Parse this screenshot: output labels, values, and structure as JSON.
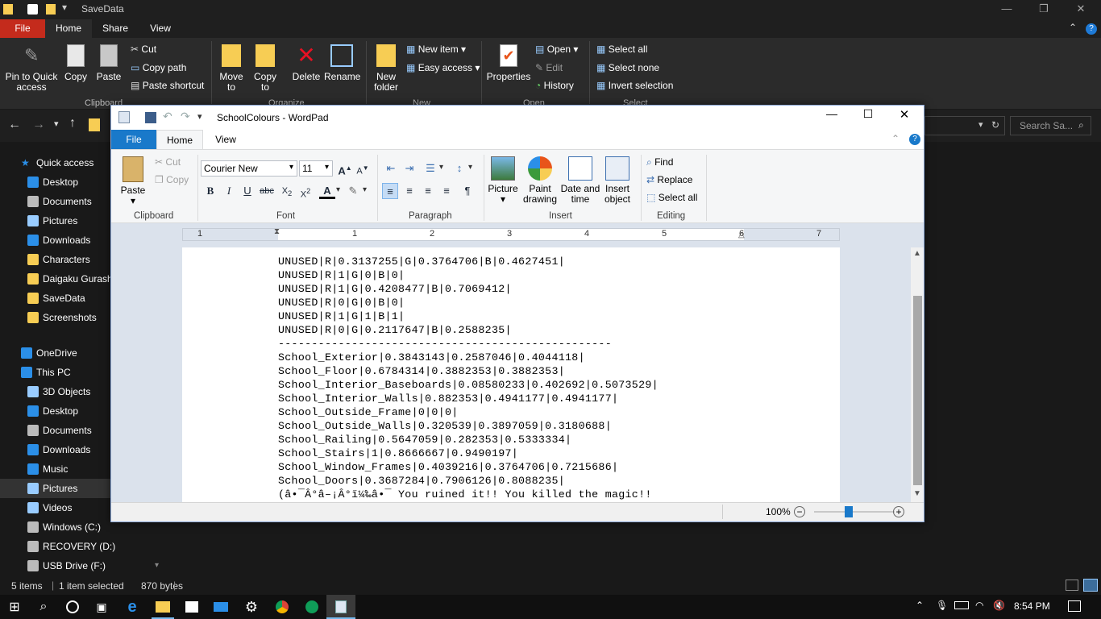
{
  "explorer": {
    "title": "SaveData",
    "tabs": {
      "file": "File",
      "home": "Home",
      "share": "Share",
      "view": "View"
    },
    "ribbon": {
      "pin": "Pin to Quick access",
      "copy": "Copy",
      "paste": "Paste",
      "cut": "Cut",
      "copy_path": "Copy path",
      "paste_shortcut": "Paste shortcut",
      "move_to": "Move to",
      "copy_to": "Copy to",
      "delete": "Delete",
      "rename": "Rename",
      "new_folder": "New folder",
      "new_item": "New item",
      "easy_access": "Easy access",
      "properties": "Properties",
      "open": "Open",
      "edit": "Edit",
      "history": "History",
      "select_all": "Select all",
      "select_none": "Select none",
      "invert_selection": "Invert selection",
      "groups": {
        "clipboard": "Clipboard",
        "organize": "Organize",
        "new": "New",
        "open": "Open",
        "select": "Select"
      }
    },
    "search_placeholder": "Search Sa...",
    "nav": [
      {
        "label": "Quick access",
        "icon": "star-icon"
      },
      {
        "label": "Desktop",
        "icon": "desktop-icon"
      },
      {
        "label": "Documents",
        "icon": "documents-icon"
      },
      {
        "label": "Pictures",
        "icon": "pictures-icon"
      },
      {
        "label": "Downloads",
        "icon": "downloads-icon"
      },
      {
        "label": "Characters",
        "icon": "folder-icon"
      },
      {
        "label": "Daigaku Gurashi",
        "icon": "folder-icon"
      },
      {
        "label": "SaveData",
        "icon": "folder-icon"
      },
      {
        "label": "Screenshots",
        "icon": "folder-icon"
      },
      {
        "label": "OneDrive",
        "icon": "cloud-icon"
      },
      {
        "label": "This PC",
        "icon": "pc-icon"
      },
      {
        "label": "3D Objects",
        "icon": "cube-icon"
      },
      {
        "label": "Desktop",
        "icon": "desktop-icon"
      },
      {
        "label": "Documents",
        "icon": "documents-icon"
      },
      {
        "label": "Downloads",
        "icon": "downloads-icon"
      },
      {
        "label": "Music",
        "icon": "music-icon"
      },
      {
        "label": "Pictures",
        "icon": "pictures-icon"
      },
      {
        "label": "Videos",
        "icon": "videos-icon"
      },
      {
        "label": "Windows (C:)",
        "icon": "drive-icon"
      },
      {
        "label": "RECOVERY (D:)",
        "icon": "drive-icon"
      },
      {
        "label": "USB Drive (F:)",
        "icon": "usb-icon"
      }
    ],
    "status": {
      "items": "5 items",
      "selected": "1 item selected",
      "size": "870 bytes"
    }
  },
  "wordpad": {
    "title": "SchoolColours - WordPad",
    "tabs": {
      "file": "File",
      "home": "Home",
      "view": "View"
    },
    "ribbon": {
      "paste": "Paste",
      "cut": "Cut",
      "copy": "Copy",
      "font_name": "Courier New",
      "font_size": "11",
      "picture": "Picture",
      "paint": "Paint drawing",
      "datetime": "Date and time",
      "insert_object": "Insert object",
      "find": "Find",
      "replace": "Replace",
      "select_all": "Select all",
      "groups": {
        "clipboard": "Clipboard",
        "font": "Font",
        "paragraph": "Paragraph",
        "insert": "Insert",
        "editing": "Editing"
      }
    },
    "ruler": [
      "1",
      "2",
      "3",
      "4",
      "5",
      "6",
      "7"
    ],
    "lines": [
      "UNUSED|R|0.3137255|G|0.3764706|B|0.4627451|",
      "UNUSED|R|1|G|0|B|0|",
      "UNUSED|R|1|G|0.4208477|B|0.7069412|",
      "UNUSED|R|0|G|0|B|0|",
      "UNUSED|R|1|G|1|B|1|",
      "UNUSED|R|0|G|0.2117647|B|0.2588235|",
      "--------------------------------------------------",
      "School_Exterior|0.3843143|0.2587046|0.4044118|",
      "School_Floor|0.6784314|0.3882353|0.3882353|",
      "School_Interior_Baseboards|0.08580233|0.402692|0.5073529|",
      "School_Interior_Walls|0.882353|0.4941177|0.4941177|",
      "School_Outside_Frame|0|0|0|",
      "School_Outside_Walls|0.320539|0.3897059|0.3180688|",
      "School_Railing|0.5647059|0.282353|0.5333334|",
      "School_Stairs|1|0.8666667|0.9490197|",
      "School_Window_Frames|0.4039216|0.3764706|0.7215686|",
      "School_Doors|0.3687284|0.7906126|0.8088235|",
      "(â•¯Â°â–¡Â°ï¼‰â•¯ You ruined it!! You killed the magic!!"
    ],
    "zoom": "100%"
  },
  "taskbar": {
    "time": "8:54 PM"
  }
}
